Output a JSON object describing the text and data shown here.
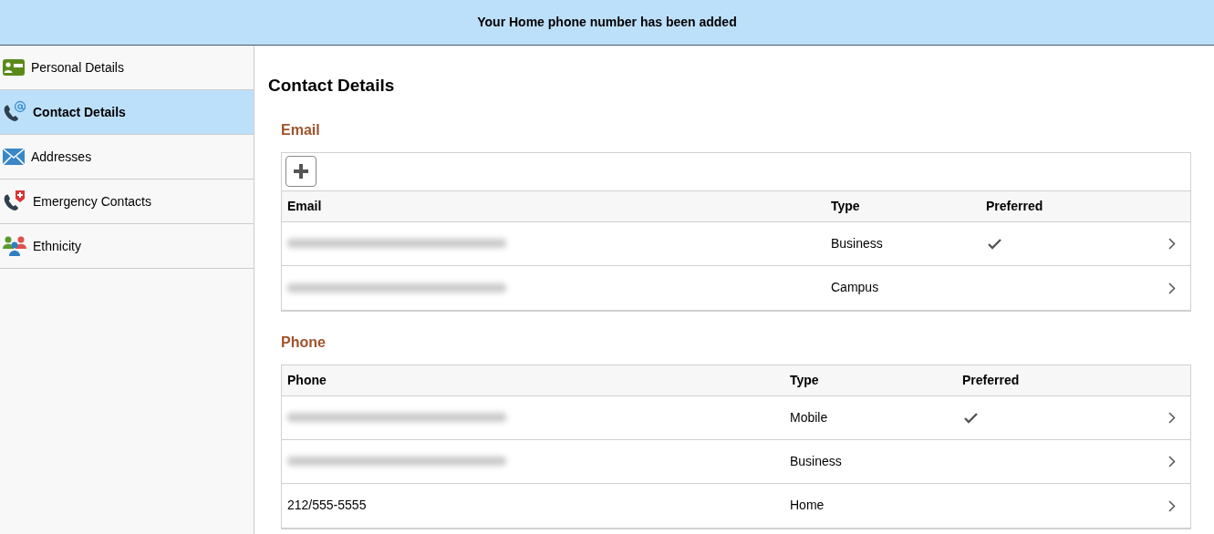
{
  "banner": {
    "message": "Your Home phone number has been added"
  },
  "sidebar": {
    "items": [
      {
        "label": "Personal Details",
        "selected": false,
        "kind": "person"
      },
      {
        "label": "Contact Details",
        "selected": true,
        "kind": "contact"
      },
      {
        "label": "Addresses",
        "selected": false,
        "kind": "mail"
      },
      {
        "label": "Emergency Contacts",
        "selected": false,
        "kind": "emergency"
      },
      {
        "label": "Ethnicity",
        "selected": false,
        "kind": "people"
      }
    ]
  },
  "page_title": "Contact Details",
  "sections": [
    {
      "kind": "email",
      "title": "Email",
      "add_button": true,
      "columns": [
        "Email",
        "Type",
        "Preferred"
      ],
      "rows": [
        {
          "value": "",
          "redacted": true,
          "type": "Business",
          "preferred": true
        },
        {
          "value": "",
          "redacted": true,
          "type": "Campus",
          "preferred": false
        }
      ]
    },
    {
      "kind": "phone",
      "title": "Phone",
      "add_button": false,
      "columns": [
        "Phone",
        "Type",
        "Preferred"
      ],
      "rows": [
        {
          "value": "",
          "redacted": true,
          "type": "Mobile",
          "preferred": true
        },
        {
          "value": "",
          "redacted": true,
          "type": "Business",
          "preferred": false
        },
        {
          "value": "212/555-5555",
          "redacted": false,
          "type": "Home",
          "preferred": false
        }
      ]
    }
  ]
}
